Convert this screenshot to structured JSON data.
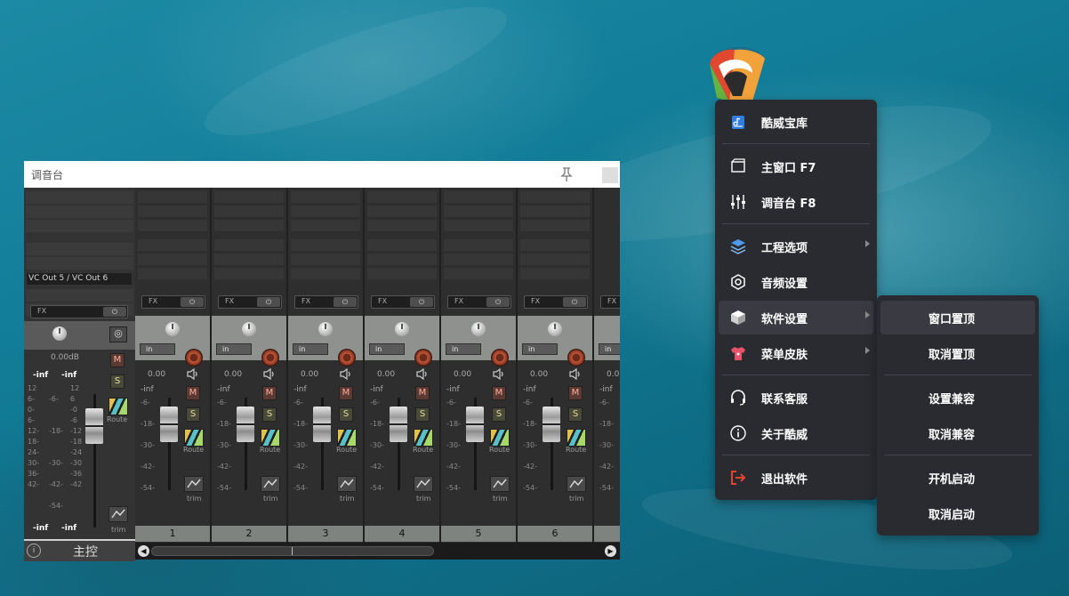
{
  "mixer": {
    "title": "调音台",
    "master": {
      "io_route": "VC Out 5 / VC Out 6",
      "fx_label": "FX",
      "volume": "0.00dB",
      "peak_left": "-inf",
      "peak_right": "-inf",
      "mute": "M",
      "solo": "S",
      "route": "Route",
      "trim": "trim",
      "bottom_left": "-inf",
      "bottom_right": "-inf",
      "label": "主控"
    },
    "channel_common": {
      "fx_label": "FX",
      "input": "in",
      "volume": "0.00",
      "peak": "-inf",
      "mute": "M",
      "solo": "S",
      "route": "Route",
      "trim": "trim"
    },
    "channels": [
      "1",
      "2",
      "3",
      "4",
      "5",
      "6"
    ],
    "partial_channel": {
      "input": "in",
      "volume": "0.0"
    }
  },
  "menu": {
    "items": [
      {
        "label": "酷威宝库",
        "icon": "app-store-icon"
      },
      {
        "label": "主窗口  F7",
        "icon": "window-icon"
      },
      {
        "label": "调音台  F8",
        "icon": "sliders-icon"
      },
      {
        "label": "工程选项",
        "icon": "layers-icon",
        "submenu": true
      },
      {
        "label": "音频设置",
        "icon": "hexagon-settings-icon"
      },
      {
        "label": "软件设置",
        "icon": "cube-icon",
        "submenu": true
      },
      {
        "label": "菜单皮肤",
        "icon": "shirt-icon",
        "submenu": true
      },
      {
        "label": "联系客服",
        "icon": "headset-icon"
      },
      {
        "label": "关于酷威",
        "icon": "info-icon"
      },
      {
        "label": "退出软件",
        "icon": "exit-icon"
      }
    ]
  },
  "submenu": {
    "items": [
      "窗口置顶",
      "取消置顶",
      "设置兼容",
      "取消兼容",
      "开机启动",
      "取消启动"
    ]
  }
}
